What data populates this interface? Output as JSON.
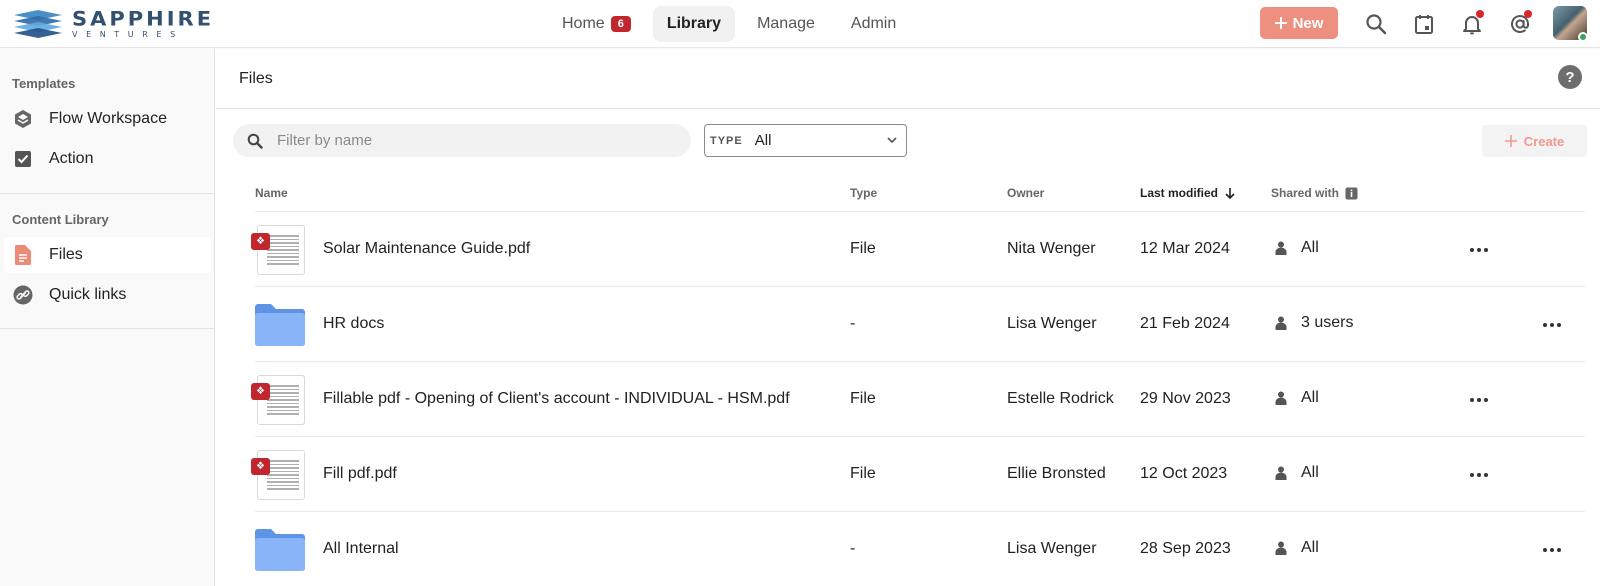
{
  "brand": {
    "name": "SAPPHIRE",
    "sub": "VENTURES"
  },
  "nav": {
    "items": [
      {
        "label": "Home",
        "badge": "6"
      },
      {
        "label": "Library"
      },
      {
        "label": "Manage"
      },
      {
        "label": "Admin"
      }
    ],
    "active": "Library"
  },
  "toolbar": {
    "new_label": "New"
  },
  "sidebar": {
    "sections": [
      {
        "title": "Templates",
        "items": [
          {
            "label": "Flow Workspace",
            "icon": "layers-icon"
          },
          {
            "label": "Action",
            "icon": "checkbox-icon"
          }
        ]
      },
      {
        "title": "Content Library",
        "items": [
          {
            "label": "Files",
            "icon": "file-icon"
          },
          {
            "label": "Quick links",
            "icon": "link-icon"
          }
        ]
      }
    ],
    "active": "Files"
  },
  "main": {
    "title": "Files",
    "search_placeholder": "Filter by name",
    "type_label": "TYPE",
    "type_value": "All",
    "create_label": "Create"
  },
  "table": {
    "columns": [
      "Name",
      "Type",
      "Owner",
      "Last modified",
      "Shared with"
    ],
    "sorted_column": "Last modified",
    "rows": [
      {
        "name": "Solar Maintenance Guide.pdf",
        "kind": "pdf",
        "type": "File",
        "owner": "Nita Wenger",
        "modified": "12 Mar 2024",
        "shared": "All"
      },
      {
        "name": "HR docs",
        "kind": "folder",
        "type": "-",
        "owner": "Lisa Wenger",
        "modified": "21 Feb 2024",
        "shared": "3 users"
      },
      {
        "name": "Fillable pdf - Opening of Client's account - INDIVIDUAL - HSM.pdf",
        "kind": "pdf",
        "type": "File",
        "owner": "Estelle Rodrick",
        "modified": "29 Nov 2023",
        "shared": "All"
      },
      {
        "name": "Fill pdf.pdf",
        "kind": "pdf",
        "type": "File",
        "owner": "Ellie Bronsted",
        "modified": "12 Oct 2023",
        "shared": "All"
      },
      {
        "name": "All Internal",
        "kind": "folder",
        "type": "-",
        "owner": "Lisa Wenger",
        "modified": "28 Sep 2023",
        "shared": "All"
      }
    ]
  },
  "colors": {
    "accent": "#ee9080",
    "badge": "#c0262d",
    "folder": "#8ab4f8",
    "pdf": "#c0262d"
  }
}
